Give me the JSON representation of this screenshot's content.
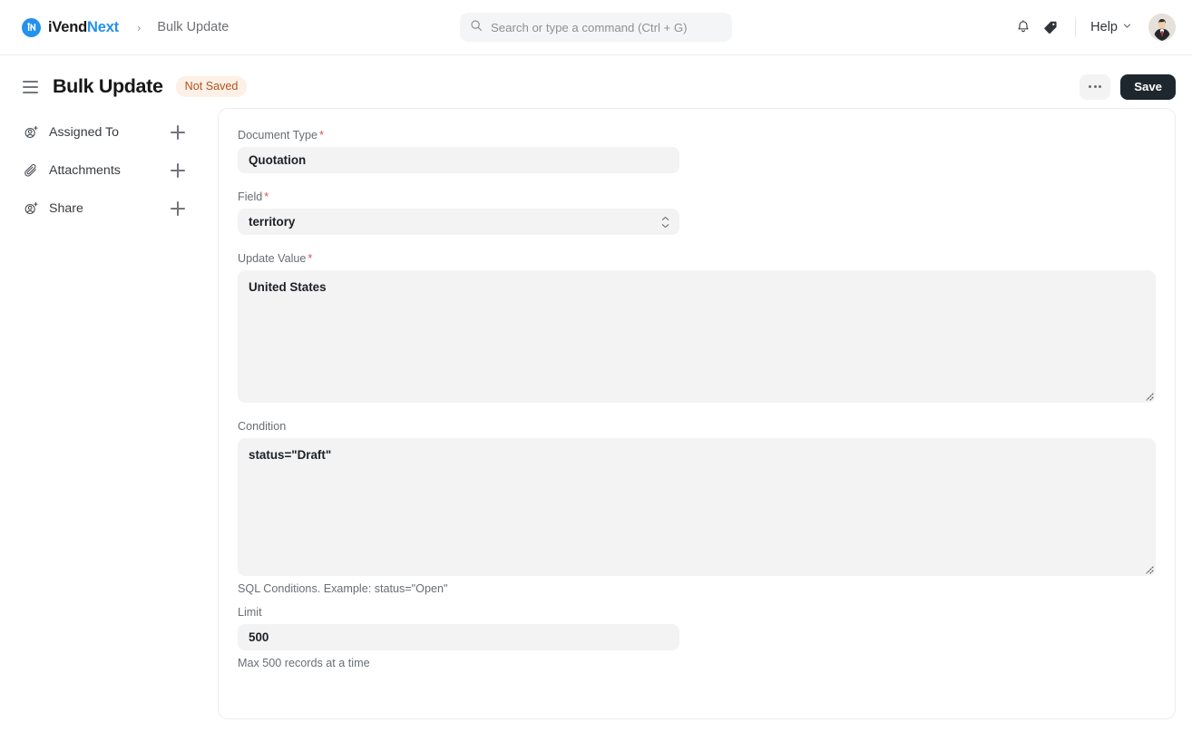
{
  "navbar": {
    "brand_first": "iVend",
    "brand_second": "Next",
    "brand_logo_icon": "ivend-circle-logo",
    "breadcrumb_separator": "›",
    "breadcrumb_current": "Bulk Update",
    "search": {
      "placeholder": "Search or type a command (Ctrl + G)",
      "value": "",
      "icon": "search-icon"
    },
    "notifications_icon": "bell-icon",
    "tags_icon": "tag-icon",
    "help_label": "Help",
    "help_caret_icon": "chevron-down-icon",
    "avatar_icon": "user-avatar"
  },
  "page_head": {
    "menu_icon": "hamburger-menu-icon",
    "title": "Bulk Update",
    "status_badge": "Not Saved",
    "more_label": "···",
    "save_label": "Save"
  },
  "sidebar": {
    "items": [
      {
        "label": "Assigned To",
        "icon": "user-plus-icon",
        "add_icon": "plus-icon"
      },
      {
        "label": "Attachments",
        "icon": "paperclip-icon",
        "add_icon": "plus-icon"
      },
      {
        "label": "Share",
        "icon": "share-user-icon",
        "add_icon": "plus-icon"
      }
    ]
  },
  "form": {
    "document_type": {
      "label": "Document Type",
      "required": "*",
      "value": "Quotation",
      "placeholder": ""
    },
    "field": {
      "label": "Field",
      "required": "*",
      "value": "territory",
      "caret_icon": "select-updown-icon"
    },
    "update_value": {
      "label": "Update Value",
      "required": "*",
      "value": "United States",
      "placeholder": ""
    },
    "condition": {
      "label": "Condition",
      "required": "",
      "value": "status=\"Draft\"",
      "placeholder": "",
      "help": "SQL Conditions. Example: status=\"Open\""
    },
    "limit": {
      "label": "Limit",
      "required": "",
      "value": "500",
      "placeholder": "",
      "help": "Max 500 records at a time"
    }
  },
  "colors": {
    "brand_blue": "#2490ef",
    "badge_bg": "#fdf0e6",
    "badge_text": "#b5521f",
    "input_bg": "#f3f3f3",
    "save_bg": "#1f272e",
    "required_red": "#e24c4c"
  }
}
